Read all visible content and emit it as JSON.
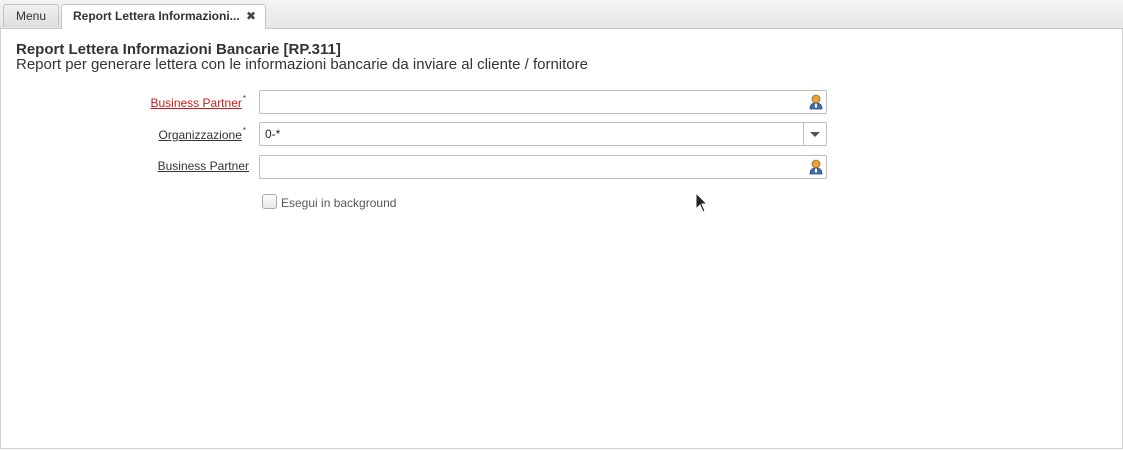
{
  "tabs": {
    "menu_label": "Menu",
    "active_label": "Report Lettera Informazioni...",
    "close_glyph": "✖"
  },
  "header": {
    "title": "Report Lettera Informazioni Bancarie [RP.311]",
    "subtitle": "Report per generare lettera con le informazioni bancarie da inviare al cliente / fornitore"
  },
  "form": {
    "fields": [
      {
        "label": "Business Partner",
        "required": true,
        "value": "",
        "icon": "business-partner-icon"
      },
      {
        "label": "Organizzazione",
        "required": true,
        "value": "0-*",
        "icon": "chevron-down-icon"
      },
      {
        "label": "Business Partner",
        "required": false,
        "value": "",
        "icon": "business-partner-icon"
      }
    ],
    "required_marker": "*",
    "background_checkbox": {
      "label": "Esegui in background",
      "checked": false
    }
  },
  "colors": {
    "required_label": "#cc1a1a",
    "border": "#bdbdbd"
  }
}
